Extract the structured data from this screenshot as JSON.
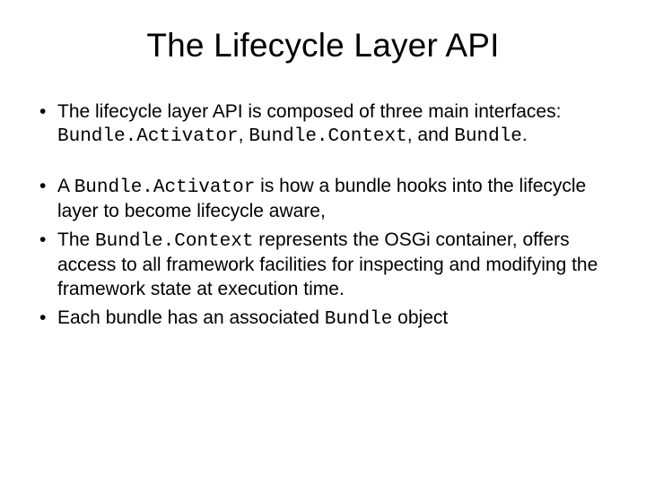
{
  "title": "The Lifecycle Layer API",
  "b1": {
    "t1": "The lifecycle layer API is composed of three main interfaces: ",
    "c1": "Bundle.Activator",
    "t2": ", ",
    "c2": "Bundle.Context",
    "t3": ", and ",
    "c3": "Bundle",
    "t4": "."
  },
  "b2": {
    "t1": "A ",
    "c1": "Bundle.Activator",
    "t2": " is how a bundle hooks into the lifecycle layer to become lifecycle aware,"
  },
  "b3": {
    "t1": "The ",
    "c1": "Bundle.Context",
    "t2": " represents the OSGi container, offers access to all framework facilities for inspecting and modifying the framework state at execution time."
  },
  "b4": {
    "t1": "Each bundle has an associated ",
    "c1": "Bundle",
    "t2": " object"
  }
}
